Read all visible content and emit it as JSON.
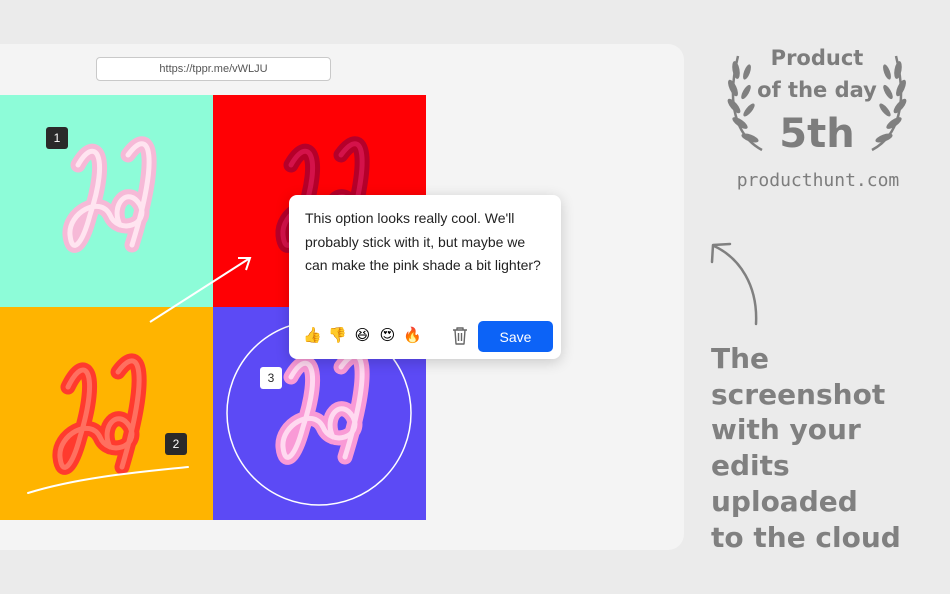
{
  "browser": {
    "url": "https://tppr.me/vWLJU"
  },
  "canvas": {
    "tiles": [
      {
        "name": "mint-tile",
        "color": "#8dfcd8"
      },
      {
        "name": "red-tile",
        "color": "#ff0004"
      },
      {
        "name": "orange-tile",
        "color": "#ffb400"
      },
      {
        "name": "violet-tile",
        "color": "#5c4af5"
      }
    ],
    "markers": [
      "1",
      "2",
      "3"
    ]
  },
  "comment": {
    "text": "This option looks really cool. We'll probably stick with it, but maybe we can make the pink shade a bit lighter?",
    "reactions": [
      "👍",
      "👎",
      "😆",
      "😍",
      "🔥"
    ],
    "save_label": "Save",
    "trash_icon": "trash-icon"
  },
  "badge": {
    "line1": "Product",
    "line2": "of the day",
    "rank": "5th",
    "domain": "producthunt.com"
  },
  "tagline": [
    "The",
    "screenshot",
    "with your",
    "edits",
    "uploaded",
    "to the cloud"
  ],
  "colors": {
    "accent": "#0c63f7",
    "badge_text": "#7d7d7d"
  }
}
